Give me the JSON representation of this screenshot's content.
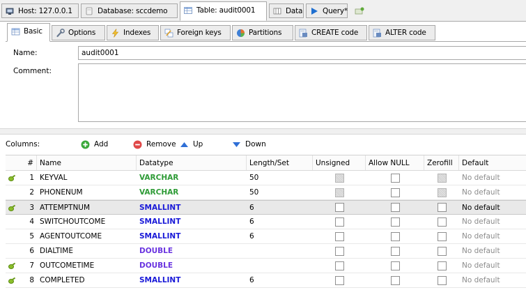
{
  "top_tabs": [
    {
      "label": "Host: 127.0.0.1",
      "icon": "host-icon"
    },
    {
      "label": "Database: sccdemo",
      "icon": "database-icon"
    },
    {
      "label": "Table: audit0001",
      "icon": "table-icon"
    },
    {
      "label": "Data",
      "icon": "data-grid-icon"
    },
    {
      "label": "Query*",
      "icon": "play-icon"
    },
    {
      "label": "",
      "icon": "new-query-tab-icon"
    }
  ],
  "inner_tabs": [
    {
      "label": "Basic",
      "icon": "table-icon"
    },
    {
      "label": "Options",
      "icon": "wrench-icon"
    },
    {
      "label": "Indexes",
      "icon": "lightning-icon"
    },
    {
      "label": "Foreign keys",
      "icon": "foreign-key-icon"
    },
    {
      "label": "Partitions",
      "icon": "pie-icon"
    },
    {
      "label": "CREATE code",
      "icon": "sql-code-icon"
    },
    {
      "label": "ALTER code",
      "icon": "sql-code-icon"
    }
  ],
  "form": {
    "name_label": "Name:",
    "name_value": "audit0001",
    "comment_label": "Comment:",
    "comment_value": ""
  },
  "toolbar": {
    "columns_label": "Columns:",
    "add": "Add",
    "remove": "Remove",
    "up": "Up",
    "down": "Down"
  },
  "grid": {
    "headers": [
      "#",
      "Name",
      "Datatype",
      "Length/Set",
      "Unsigned",
      "Allow NULL",
      "Zerofill",
      "Default"
    ],
    "rows": [
      {
        "num": "1",
        "name": "KEYVAL",
        "datatype": "VARCHAR",
        "dtype_class": "varchar",
        "length": "50",
        "unsigned_disabled": true,
        "zerofill_disabled": true,
        "default": "No default",
        "key": true
      },
      {
        "num": "2",
        "name": "PHONENUM",
        "datatype": "VARCHAR",
        "dtype_class": "varchar",
        "length": "50",
        "unsigned_disabled": true,
        "zerofill_disabled": true,
        "default": "No default",
        "key": false
      },
      {
        "num": "3",
        "name": "ATTEMPTNUM",
        "datatype": "SMALLINT",
        "dtype_class": "int",
        "length": "6",
        "unsigned_disabled": false,
        "zerofill_disabled": false,
        "default": "No default",
        "key": true,
        "selected": true
      },
      {
        "num": "4",
        "name": "SWITCHOUTCOME",
        "datatype": "SMALLINT",
        "dtype_class": "int",
        "length": "6",
        "unsigned_disabled": false,
        "zerofill_disabled": false,
        "default": "No default",
        "key": false
      },
      {
        "num": "5",
        "name": "AGENTOUTCOME",
        "datatype": "SMALLINT",
        "dtype_class": "int",
        "length": "6",
        "unsigned_disabled": false,
        "zerofill_disabled": false,
        "default": "No default",
        "key": false
      },
      {
        "num": "6",
        "name": "DIALTIME",
        "datatype": "DOUBLE",
        "dtype_class": "double",
        "length": "",
        "unsigned_disabled": false,
        "zerofill_disabled": false,
        "default": "No default",
        "key": false
      },
      {
        "num": "7",
        "name": "OUTCOMETIME",
        "datatype": "DOUBLE",
        "dtype_class": "double",
        "length": "",
        "unsigned_disabled": false,
        "zerofill_disabled": false,
        "default": "No default",
        "key": true
      },
      {
        "num": "8",
        "name": "COMPLETED",
        "datatype": "SMALLINT",
        "dtype_class": "int",
        "length": "6",
        "unsigned_disabled": false,
        "zerofill_disabled": false,
        "default": "No default",
        "key": true
      }
    ]
  },
  "colors": {
    "varchar": "#2e9b36",
    "int": "#1a1ad8",
    "double": "#6a34e0",
    "add_icon": "#3aa83a",
    "remove_icon": "#e04848",
    "arrow_icon": "#2f6fd6"
  }
}
